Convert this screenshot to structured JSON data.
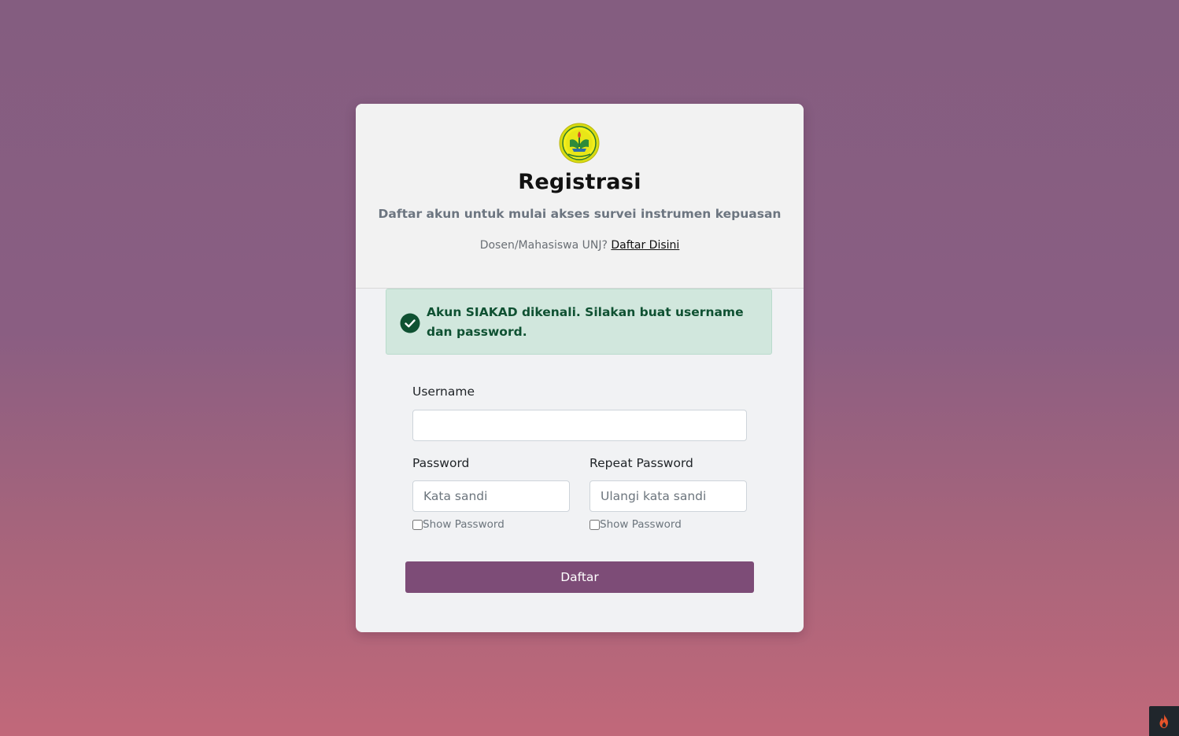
{
  "header": {
    "title": "Registrasi",
    "subtitle": "Daftar akun untuk mulai akses survei instrumen kepuasan",
    "note_prefix": "Dosen/Mahasiswa UNJ?",
    "note_link": "Daftar Disini",
    "logo_icon": "unj-logo-icon"
  },
  "alert": {
    "icon": "check-circle-icon",
    "text": "Akun SIAKAD dikenali. Silakan buat username dan password.",
    "color": "#0f5132",
    "background": "#d1e7dd"
  },
  "form": {
    "username": {
      "label": "Username",
      "value": "",
      "placeholder": ""
    },
    "password": {
      "label": "Password",
      "value": "",
      "placeholder": "Kata sandi",
      "show_label": "Show Password"
    },
    "repeat_password": {
      "label": "Repeat Password",
      "value": "",
      "placeholder": "Ulangi kata sandi",
      "show_label": "Show Password"
    },
    "submit_label": "Daftar"
  },
  "colors": {
    "accent": "#7d4c77",
    "background_top": "#845d80",
    "background_bottom": "#c1687a"
  },
  "corner_badge": {
    "icon": "flame-icon"
  }
}
